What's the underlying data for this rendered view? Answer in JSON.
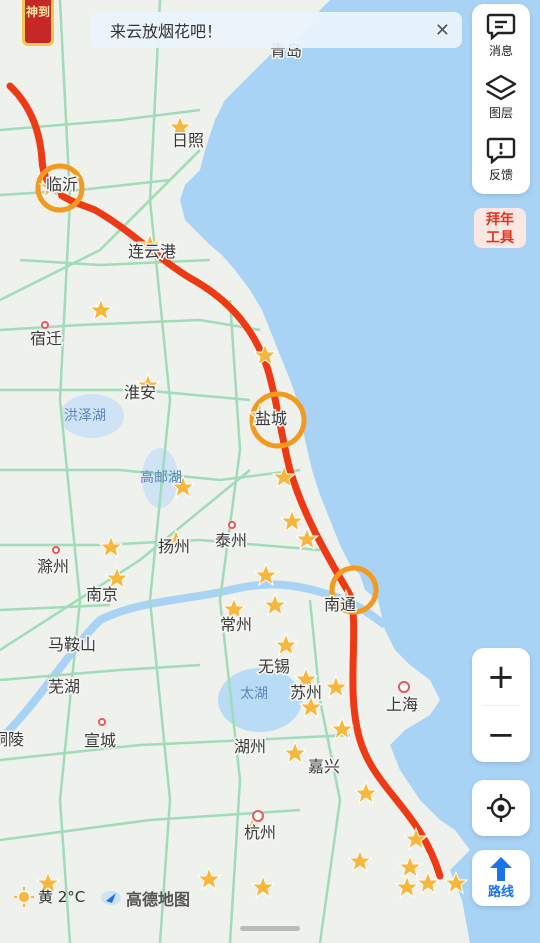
{
  "notice": {
    "text": "来云放烟花吧！"
  },
  "badge": {
    "text": "神到"
  },
  "toolbar": {
    "messages": "消息",
    "layers": "图层",
    "feedback": "反馈"
  },
  "promo": {
    "text": "拜年工具"
  },
  "route_button": {
    "label": "路线"
  },
  "weather": {
    "text": "黄 2°C"
  },
  "brand": {
    "text": "高德地图"
  },
  "map": {
    "top_partial_label": "青岛",
    "cities": [
      {
        "name": "日照",
        "color": "#3a3a3a"
      },
      {
        "name": "临沂",
        "color": "#3a3a3a"
      },
      {
        "name": "连云港",
        "color": "#3a3a3a"
      },
      {
        "name": "宿迁",
        "color": "#3a3a3a"
      },
      {
        "name": "淮安",
        "color": "#3a3a3a"
      },
      {
        "name": "盐城",
        "color": "#3a3a3a"
      },
      {
        "name": "扬州",
        "color": "#3a3a3a"
      },
      {
        "name": "泰州",
        "color": "#3a3a3a"
      },
      {
        "name": "滁州",
        "color": "#3a3a3a"
      },
      {
        "name": "南京",
        "color": "#3a3a3a"
      },
      {
        "name": "南通",
        "color": "#3a3a3a"
      },
      {
        "name": "常州",
        "color": "#3a3a3a"
      },
      {
        "name": "马鞍山",
        "color": "#3a3a3a"
      },
      {
        "name": "无锡",
        "color": "#3a3a3a"
      },
      {
        "name": "苏州",
        "color": "#3a3a3a"
      },
      {
        "name": "芜湖",
        "color": "#3a3a3a"
      },
      {
        "name": "上海",
        "color": "#3a3a3a"
      },
      {
        "name": "宣城",
        "color": "#3a3a3a"
      },
      {
        "name": "湖州",
        "color": "#3a3a3a"
      },
      {
        "name": "嘉兴",
        "color": "#3a3a3a"
      },
      {
        "name": "杭州",
        "color": "#3a3a3a"
      },
      {
        "name": "铜陵",
        "color": "#3a3a3a"
      }
    ],
    "lakes": [
      "洪泽湖",
      "高邮湖",
      "太湖"
    ],
    "colors": {
      "land": "#eef1ec",
      "sea": "#a9d3f5",
      "road": "#9fdcb7",
      "route": "#ee3a14",
      "marker_ring": "#f39a1e",
      "star": "#f6b73c"
    }
  }
}
